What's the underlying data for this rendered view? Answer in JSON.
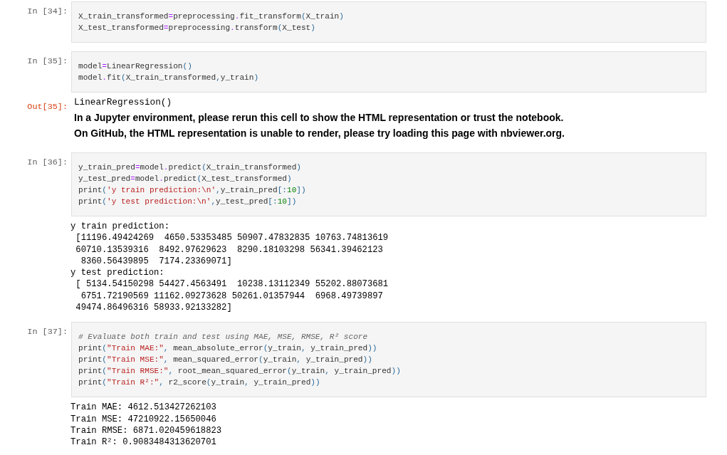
{
  "cells": [
    {
      "kind": "code",
      "prompt": "In [34]:",
      "lines": [
        [
          {
            "kind": "name",
            "text": "X_train_transformed"
          },
          {
            "kind": "op",
            "text": "="
          },
          {
            "kind": "name",
            "text": "preprocessing"
          },
          {
            "kind": "op",
            "text": "."
          },
          {
            "kind": "name",
            "text": "fit_transform"
          },
          {
            "kind": "punct",
            "text": "("
          },
          {
            "kind": "name",
            "text": "X_train"
          },
          {
            "kind": "punct",
            "text": ")"
          }
        ],
        [
          {
            "kind": "name",
            "text": "X_test_transformed"
          },
          {
            "kind": "op",
            "text": "="
          },
          {
            "kind": "name",
            "text": "preprocessing"
          },
          {
            "kind": "op",
            "text": "."
          },
          {
            "kind": "name",
            "text": "transform"
          },
          {
            "kind": "punct",
            "text": "("
          },
          {
            "kind": "name",
            "text": "X_test"
          },
          {
            "kind": "punct",
            "text": ")"
          }
        ]
      ]
    },
    {
      "kind": "code",
      "prompt": "In [35]:",
      "lines": [
        [
          {
            "kind": "name",
            "text": "model"
          },
          {
            "kind": "op",
            "text": "="
          },
          {
            "kind": "name",
            "text": "LinearRegression"
          },
          {
            "kind": "punct",
            "text": "()"
          }
        ],
        [
          {
            "kind": "name",
            "text": "model"
          },
          {
            "kind": "op",
            "text": "."
          },
          {
            "kind": "name",
            "text": "fit"
          },
          {
            "kind": "punct",
            "text": "("
          },
          {
            "kind": "name",
            "text": "X_train_transformed"
          },
          {
            "kind": "punct",
            "text": ","
          },
          {
            "kind": "name",
            "text": "y_train"
          },
          {
            "kind": "punct",
            "text": ")"
          }
        ]
      ]
    },
    {
      "kind": "result",
      "prompt": "Out[35]:",
      "repr": "LinearRegression()",
      "notes": [
        "In a Jupyter environment, please rerun this cell to show the HTML representation or trust the notebook.",
        "On GitHub, the HTML representation is unable to render, please try loading this page with nbviewer.org."
      ]
    },
    {
      "kind": "code",
      "prompt": "In [36]:",
      "lines": [
        [
          {
            "kind": "name",
            "text": "y_train_pred"
          },
          {
            "kind": "op",
            "text": "="
          },
          {
            "kind": "name",
            "text": "model"
          },
          {
            "kind": "op",
            "text": "."
          },
          {
            "kind": "name",
            "text": "predict"
          },
          {
            "kind": "punct",
            "text": "("
          },
          {
            "kind": "name",
            "text": "X_train_transformed"
          },
          {
            "kind": "punct",
            "text": ")"
          }
        ],
        [
          {
            "kind": "name",
            "text": "y_test_pred"
          },
          {
            "kind": "op",
            "text": "="
          },
          {
            "kind": "name",
            "text": "model"
          },
          {
            "kind": "op",
            "text": "."
          },
          {
            "kind": "name",
            "text": "predict"
          },
          {
            "kind": "punct",
            "text": "("
          },
          {
            "kind": "name",
            "text": "X_test_transformed"
          },
          {
            "kind": "punct",
            "text": ")"
          }
        ],
        [
          {
            "kind": "builtin",
            "text": "print"
          },
          {
            "kind": "punct",
            "text": "("
          },
          {
            "kind": "string",
            "text": "'y train prediction:\\n'"
          },
          {
            "kind": "punct",
            "text": ","
          },
          {
            "kind": "name",
            "text": "y_train_pred"
          },
          {
            "kind": "punct",
            "text": "[:"
          },
          {
            "kind": "number",
            "text": "10"
          },
          {
            "kind": "punct",
            "text": "])"
          }
        ],
        [
          {
            "kind": "builtin",
            "text": "print"
          },
          {
            "kind": "punct",
            "text": "("
          },
          {
            "kind": "string",
            "text": "'y test prediction:\\n'"
          },
          {
            "kind": "punct",
            "text": ","
          },
          {
            "kind": "name",
            "text": "y_test_pred"
          },
          {
            "kind": "punct",
            "text": "[:"
          },
          {
            "kind": "number",
            "text": "10"
          },
          {
            "kind": "punct",
            "text": "])"
          }
        ]
      ]
    },
    {
      "kind": "stream",
      "text": "y train prediction:\n [11196.49424269  4650.53353485 50907.47832835 10763.74813619\n 60710.13539316  8492.97629623  8290.18103298 56341.39462123\n  8360.56439895  7174.23369071]\ny test prediction:\n [ 5134.54150298 54427.4563491  10238.13112349 55202.88073681\n  6751.72190569 11162.09273628 50261.01357944  6968.49739897\n 49474.86496316 58933.92133282]"
    },
    {
      "kind": "code",
      "prompt": "In [37]:",
      "lines": [
        [
          {
            "kind": "comment",
            "text": "# Evaluate both train and test using MAE, MSE, RMSE, R² score"
          }
        ],
        [
          {
            "kind": "builtin",
            "text": "print"
          },
          {
            "kind": "punct",
            "text": "("
          },
          {
            "kind": "string",
            "text": "\"Train MAE:\""
          },
          {
            "kind": "punct",
            "text": ", "
          },
          {
            "kind": "name",
            "text": "mean_absolute_error"
          },
          {
            "kind": "punct",
            "text": "("
          },
          {
            "kind": "name",
            "text": "y_train"
          },
          {
            "kind": "punct",
            "text": ", "
          },
          {
            "kind": "name",
            "text": "y_train_pred"
          },
          {
            "kind": "punct",
            "text": "))"
          }
        ],
        [
          {
            "kind": "builtin",
            "text": "print"
          },
          {
            "kind": "punct",
            "text": "("
          },
          {
            "kind": "string",
            "text": "\"Train MSE:\""
          },
          {
            "kind": "punct",
            "text": ", "
          },
          {
            "kind": "name",
            "text": "mean_squared_error"
          },
          {
            "kind": "punct",
            "text": "("
          },
          {
            "kind": "name",
            "text": "y_train"
          },
          {
            "kind": "punct",
            "text": ", "
          },
          {
            "kind": "name",
            "text": "y_train_pred"
          },
          {
            "kind": "punct",
            "text": "))"
          }
        ],
        [
          {
            "kind": "builtin",
            "text": "print"
          },
          {
            "kind": "punct",
            "text": "("
          },
          {
            "kind": "string",
            "text": "\"Train RMSE:\""
          },
          {
            "kind": "punct",
            "text": ", "
          },
          {
            "kind": "name",
            "text": "root_mean_squared_error"
          },
          {
            "kind": "punct",
            "text": "("
          },
          {
            "kind": "name",
            "text": "y_train"
          },
          {
            "kind": "punct",
            "text": ", "
          },
          {
            "kind": "name",
            "text": "y_train_pred"
          },
          {
            "kind": "punct",
            "text": "))"
          }
        ],
        [
          {
            "kind": "builtin",
            "text": "print"
          },
          {
            "kind": "punct",
            "text": "("
          },
          {
            "kind": "string",
            "text": "\"Train R²:\""
          },
          {
            "kind": "punct",
            "text": ", "
          },
          {
            "kind": "name",
            "text": "r2_score"
          },
          {
            "kind": "punct",
            "text": "("
          },
          {
            "kind": "name",
            "text": "y_train"
          },
          {
            "kind": "punct",
            "text": ", "
          },
          {
            "kind": "name",
            "text": "y_train_pred"
          },
          {
            "kind": "punct",
            "text": "))"
          }
        ]
      ]
    },
    {
      "kind": "stream",
      "text": "Train MAE: 4612.513427262103\nTrain MSE: 47210922.15650046\nTrain RMSE: 6871.020459618823\nTrain R²: 0.9083484313620701"
    }
  ]
}
